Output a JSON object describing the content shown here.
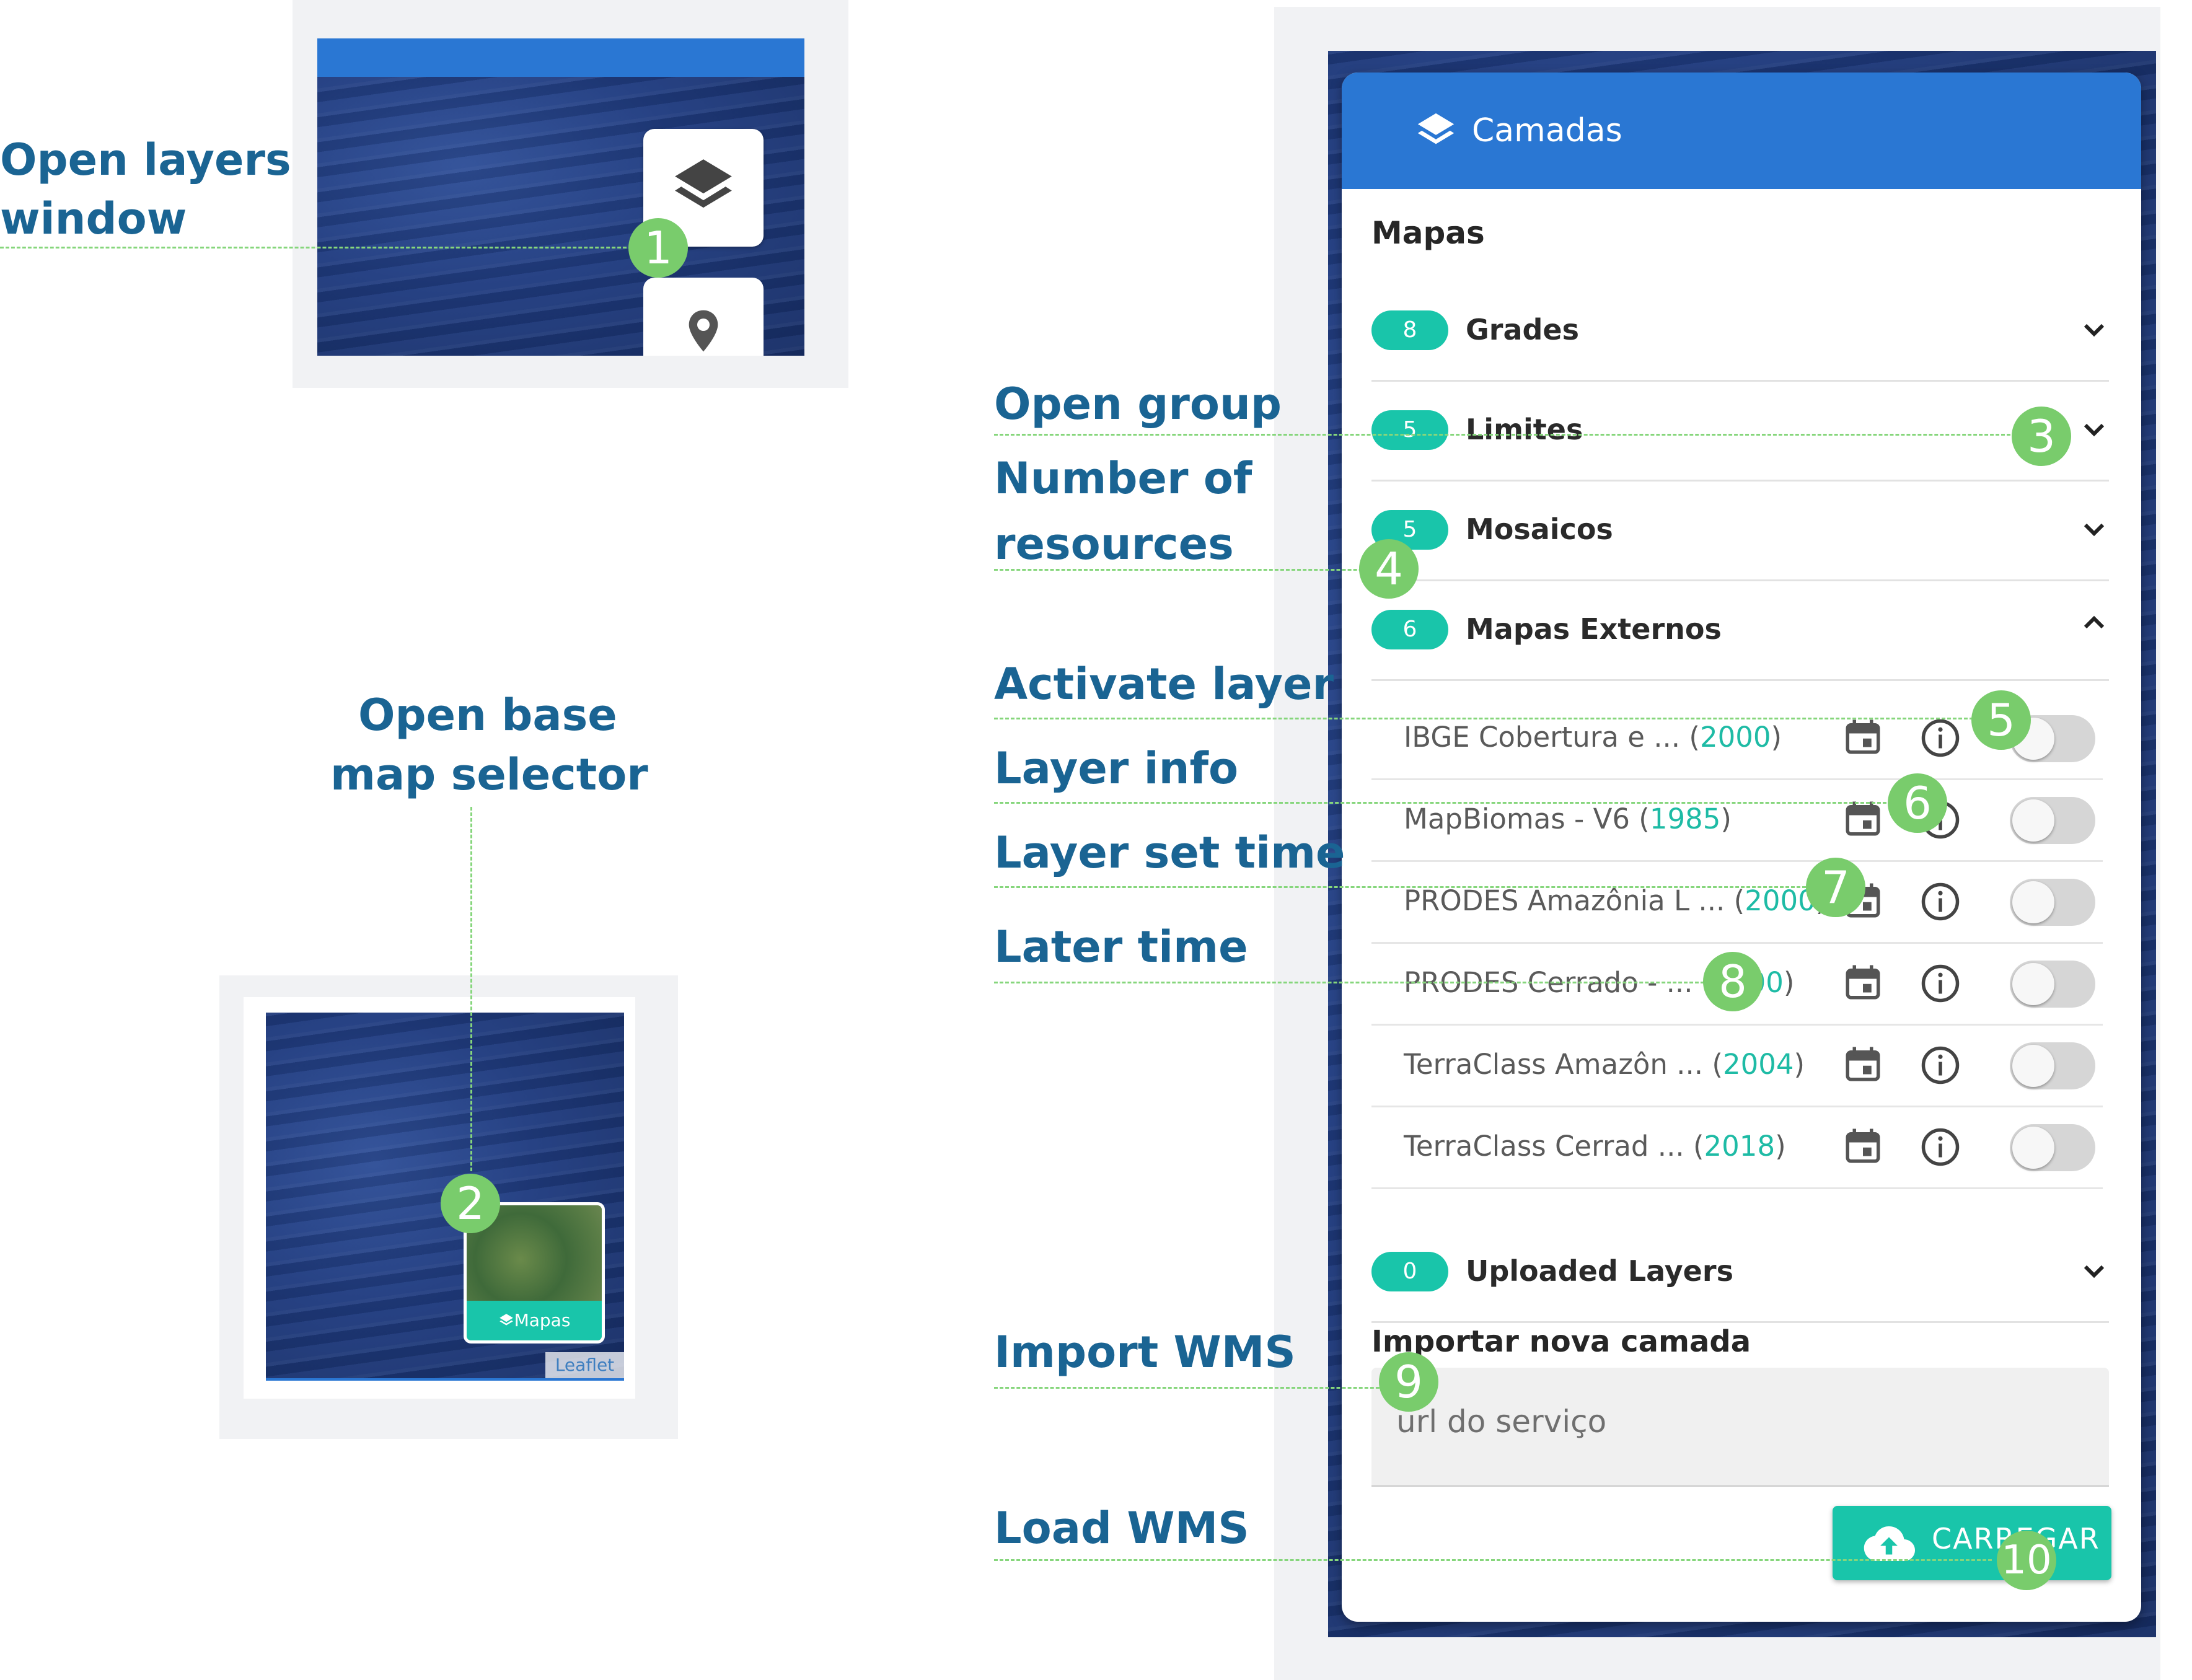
{
  "annotations": {
    "open_layers_line1": "Open layers",
    "open_layers_line2": "window",
    "open_base_line1": "Open base",
    "open_base_line2": "map selector",
    "open_group": "Open group",
    "number_line1": "Number of",
    "number_line2": "resources",
    "activate_layer": "Activate layer",
    "layer_info": "Layer info",
    "layer_set_time": "Layer set time",
    "later_time": "Later time",
    "import_wms": "Import WMS",
    "load_wms": "Load WMS"
  },
  "markers": [
    "1",
    "2",
    "3",
    "4",
    "5",
    "6",
    "7",
    "8",
    "9",
    "10"
  ],
  "basemap_widget": {
    "button_label": "Mapas",
    "attribution": "Leaflet"
  },
  "panel": {
    "title": "Camadas",
    "section_maps": "Mapas",
    "groups": [
      {
        "count": "8",
        "label": "Grades",
        "expanded": false
      },
      {
        "count": "5",
        "label": "Limites",
        "expanded": false
      },
      {
        "count": "5",
        "label": "Mosaicos",
        "expanded": false
      },
      {
        "count": "6",
        "label": "Mapas Externos",
        "expanded": true
      },
      {
        "count": "0",
        "label": "Uploaded Layers",
        "expanded": false
      }
    ],
    "layers": [
      {
        "name": "IBGE Cobertura e ... (",
        "year": "2000",
        "close": ")"
      },
      {
        "name": "MapBiomas - V6 (",
        "year": "1985",
        "close": ")"
      },
      {
        "name": "PRODES Amazônia L ... (",
        "year": "2000",
        "close": ")"
      },
      {
        "name": "PRODES Cerrado - ... (",
        "year": "2000",
        "close": ")"
      },
      {
        "name": "TerraClass Amazôn ... (",
        "year": "2004",
        "close": ")"
      },
      {
        "name": "TerraClass Cerrad ... (",
        "year": "2018",
        "close": ")"
      }
    ],
    "import_title": "Importar nova camada",
    "input_placeholder": "url do serviço",
    "load_button": "CARREGAR"
  },
  "colors": {
    "header_blue": "#2a77d3",
    "teal": "#19c5aa",
    "annotation_blue": "#1a6493",
    "marker_green": "#79cc6c"
  }
}
